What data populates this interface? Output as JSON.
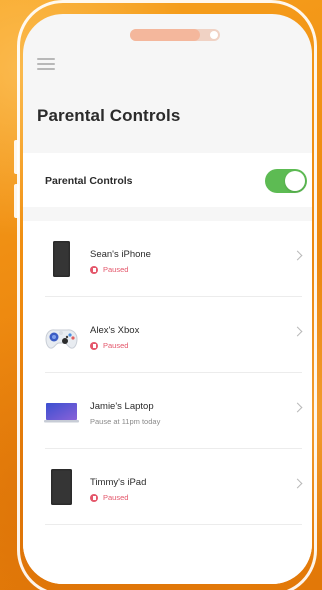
{
  "page_title": "Parental Controls",
  "toggle_setting": {
    "label": "Parental Controls",
    "enabled": true,
    "on_color": "#5dbb53"
  },
  "devices": [
    {
      "name": "Sean's iPhone",
      "status": "Paused",
      "status_type": "paused",
      "icon": "smartphone-icon"
    },
    {
      "name": "Alex's Xbox",
      "status": "Paused",
      "status_type": "paused",
      "icon": "game-controller-icon"
    },
    {
      "name": "Jamie's Laptop",
      "status": "Pause at 11pm today",
      "status_type": "scheduled",
      "icon": "laptop-icon"
    },
    {
      "name": "Timmy's iPad",
      "status": "Paused",
      "status_type": "paused",
      "icon": "tablet-icon"
    }
  ],
  "colors": {
    "paused": "#e4576b",
    "background": "#f08a14"
  }
}
